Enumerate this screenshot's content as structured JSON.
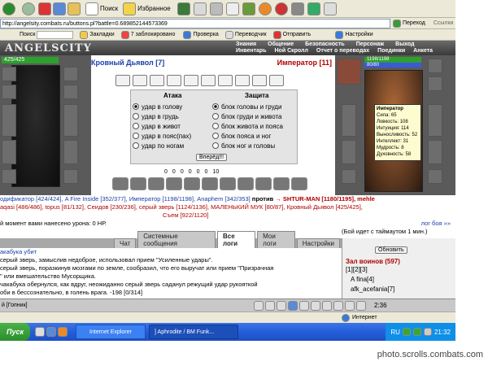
{
  "browser": {
    "menu_items": [
      "Поиск",
      "Избранное"
    ],
    "address": "http://angelsity.combats.ru/buttons.pl?battle=0.689852144573369",
    "go_label": "Переход",
    "links_label": "Ссылки",
    "search_label": "Поиск",
    "bookmarks_label": "Закладки",
    "blocked_label": "7 заблокировано",
    "check_label": "Проверка",
    "translate_label": "Переводчик",
    "send_label": "Отправить",
    "settings_label": "Настройки"
  },
  "game": {
    "logo": "ANGELSCITY",
    "top_links": [
      "Знания",
      "Общение",
      "Безопасность",
      "Персонаж",
      "Выход"
    ],
    "sub_links": [
      "Инвентарь",
      "Ной Скролл",
      "Отчет о переводах",
      "Поединки",
      "Анкета"
    ],
    "left_hp": "425/425",
    "right_hp": "1198/1198",
    "right_mp": "80/80",
    "left_name": "Кровный Дьявол [7]",
    "right_name": "Император [11]",
    "attack_title": "Атака",
    "defense_title": "Защита",
    "attacks": [
      "удар в голову",
      "удар в грудь",
      "удар в живот",
      "удар в пояс(пах)",
      "удар по ногам"
    ],
    "blocks": [
      "блок головы и груди",
      "блок груди и живота",
      "блок живота и пояса",
      "блок пояса и ног",
      "блок ног и головы"
    ],
    "forward_button": "Вперёд!!!",
    "counters": [
      "0",
      "0",
      "0",
      "0",
      "0",
      "0",
      "10"
    ],
    "tooltip": {
      "name": "Император",
      "stats": [
        "Сила: 65",
        "Ловкость: 108",
        "Интуиция: 114",
        "Выносливость: 52",
        "Интеллект: 31",
        "Мудрость: 8",
        "Духовность: 58"
      ]
    },
    "team_left": "одификатор [424/424], A Fire Inside [352/377], Император [1198/1198], Anaphem [342/353]",
    "vs": "против",
    "team_right_1": "→ SHTUR-MAN [1180/1195], mehle",
    "team_left_2": "aqasi [486/486], topus [81/132], Сеидов [230/236], серый зверь [1124/1136], МАЛЕНЬКИЙ МУК [80/87], Кровный Дьявол [425/425],",
    "team_left_3": "Съем [922/1120]",
    "damage_text": "й момент вами нанесено урона: 0 НР.",
    "log_link": "лог боя »»",
    "timeout_text": "(Бой идет с таймаутом 1 мин.)"
  },
  "chat": {
    "tabs": [
      "Чат",
      "Системные сообщения",
      "Все логи",
      "Мои логи",
      "Настройки"
    ],
    "refresh_label": "Обновить",
    "hall_title": "Зал воинов (597)",
    "pages": "[1][2][3]",
    "users": [
      "A fina[4]",
      "afk_acefania[7]"
    ],
    "log_lines": [
      "акабука убит",
      "серый зверь, замыслив недоброе, использовал прием \"Усиленные удары\".",
      "серый зверь, поразкинув мозгами по земле, сообразил, что его выручат или прием \"Призрачная",
      "\" или вмешательство Мусорщика.",
      "чакабука обернулся, как вдруг, неожиданно серый зверь саданул режущий удар рукояткой",
      "оби в бессознательно, в голень врага. -198 [0/314]"
    ],
    "bottom_left": "й [Гопник]"
  },
  "taskbar": {
    "start_label": "Пуск",
    "tasks": [
      "Internet Explorer",
      "] Aphrodite / BM Funk..."
    ],
    "lang": "RU",
    "status": "Интернет",
    "clock": "21:32",
    "clock2": "2:36"
  },
  "watermark": "photo.scrolls.combats.com",
  "colors": {
    "xp_blue": "#245edb",
    "game_dark": "#3a3a3a",
    "name_blue": "#1a3ea8",
    "name_red": "#b00000",
    "tooltip_bg": "#fdfcd0"
  }
}
